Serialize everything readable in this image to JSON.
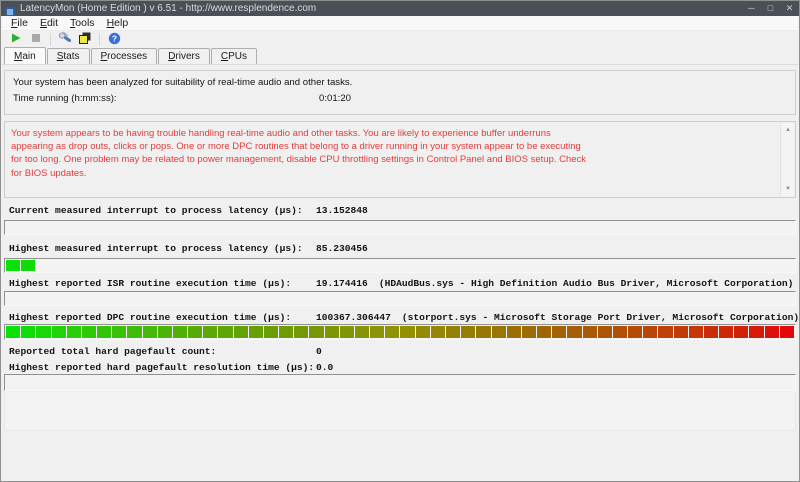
{
  "colors": {
    "titlebar_bg": "#4b5058",
    "warning_text": "#e23d3d",
    "bar_green_start": "#17d317",
    "bar_olive_mid": "#8b8b0d",
    "bar_red_end": "#ee1111",
    "play_green": "#2fae2f"
  },
  "window": {
    "title": "LatencyMon  (Home Edition )  v 6.51 - http://www.resplendence.com",
    "controls": [
      {
        "name": "minimize-button",
        "glyph": "─"
      },
      {
        "name": "maximize-button",
        "glyph": "□"
      },
      {
        "name": "close-button",
        "glyph": "✕"
      }
    ]
  },
  "menu": {
    "items": [
      "File",
      "Edit",
      "Tools",
      "Help"
    ]
  },
  "toolbar": {
    "buttons": [
      {
        "name": "start-monitor-button",
        "icon": "play-icon"
      },
      {
        "name": "stop-monitor-button",
        "icon": "stop-icon"
      },
      {
        "name": "separator"
      },
      {
        "name": "analyze-tools-button",
        "icon": "tools-icon"
      },
      {
        "name": "report-windows-button",
        "icon": "layered-windows-icon"
      },
      {
        "name": "separator"
      },
      {
        "name": "help-button",
        "icon": "help-icon"
      }
    ]
  },
  "tabs": [
    {
      "label": "Main",
      "active": true
    },
    {
      "label": "Stats",
      "active": false
    },
    {
      "label": "Processes",
      "active": false
    },
    {
      "label": "Drivers",
      "active": false
    },
    {
      "label": "CPUs",
      "active": false
    }
  ],
  "main": {
    "summary": "Your system has been analyzed for suitability of real-time audio and other tasks.",
    "time_running_label": "Time running (h:mm:ss):",
    "time_running_value": "0:01:20",
    "warning_lines": [
      "Your system appears to be having trouble handling real-time audio and other tasks. You are likely to experience buffer underruns",
      "appearing as drop outs, clicks or pops. One or more DPC routines that belong to a driver running in your system appear to be executing",
      "for too long. One problem may be related to power management, disable CPU throttling settings in Control Panel and BIOS setup. Check",
      "for BIOS updates."
    ],
    "metrics": [
      {
        "label": "Current measured interrupt to process latency (µs):",
        "value": "13.152848",
        "detail": "",
        "bar": {
          "filled_segments": 0,
          "total_segments": 52
        }
      },
      {
        "label": "Highest measured interrupt to process latency (µs):",
        "value": "85.230456",
        "detail": "",
        "bar": {
          "filled_segments": 2,
          "total_segments": 52
        }
      },
      {
        "label": "Highest reported ISR routine execution time (µs):",
        "value": "19.174416",
        "detail": "(HDAudBus.sys - High Definition Audio Bus Driver, Microsoft Corporation)",
        "bar": {
          "filled_segments": 0,
          "total_segments": 52
        }
      },
      {
        "label": "Highest reported DPC routine execution time (µs):",
        "value": "100367.306447",
        "detail": "(storport.sys - Microsoft Storage Port Driver, Microsoft Corporation)",
        "bar": {
          "filled_segments": 52,
          "total_segments": 52
        }
      },
      {
        "label": "Reported total hard pagefault count:",
        "value": "0",
        "detail": "",
        "bar": null
      },
      {
        "label": "Highest reported hard pagefault resolution time (µs):",
        "value": "0.0",
        "detail": "",
        "bar": {
          "filled_segments": 0,
          "total_segments": 52
        }
      }
    ]
  }
}
